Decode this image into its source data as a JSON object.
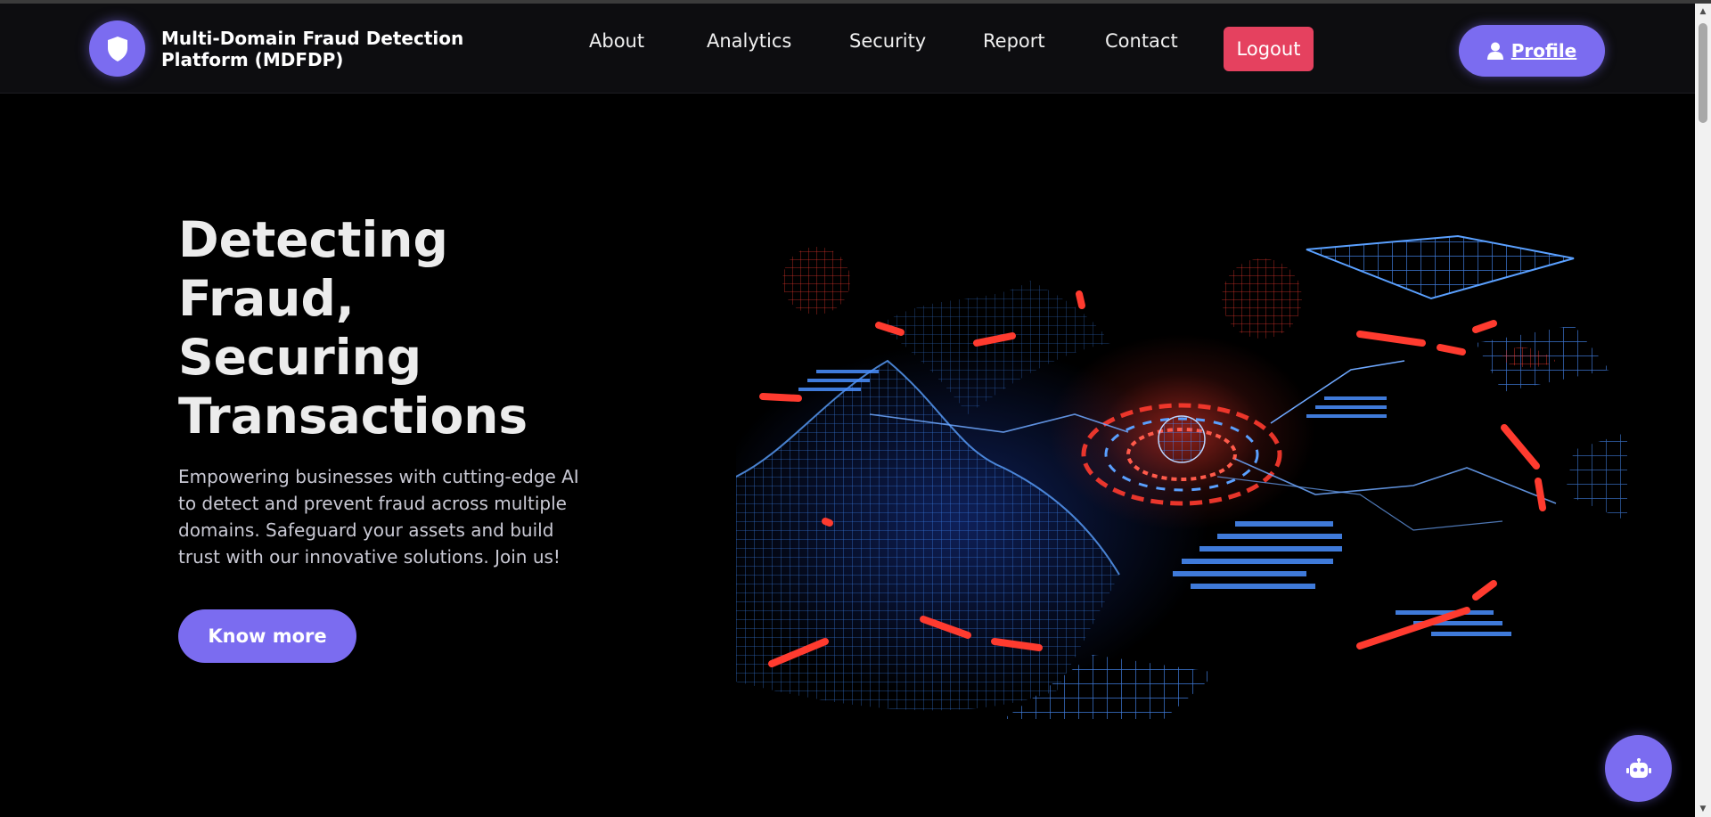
{
  "brand": {
    "name_line1": "Multi-Domain Fraud Detection",
    "name_line2": "Platform (MDFDP)",
    "logo_icon": "shield-icon"
  },
  "nav": {
    "links": [
      {
        "label": "About"
      },
      {
        "label": "Analytics"
      },
      {
        "label": "Security"
      },
      {
        "label": "Report"
      },
      {
        "label": "Contact"
      }
    ],
    "logout_label": "Logout",
    "profile_label": "Profile",
    "profile_icon": "user-icon"
  },
  "hero": {
    "title_lines": [
      "Detecting",
      "Fraud,",
      "Securing",
      "Transactions"
    ],
    "description": "Empowering businesses with cutting-edge AI to detect and prevent fraud across multiple domains. Safeguard your assets and build trust with our innovative solutions. Join us!",
    "cta_label": "Know more",
    "image": "cybersecurity-network-illustration"
  },
  "chatbot": {
    "icon": "robot-icon"
  },
  "colors": {
    "accent": "#7b6cf0",
    "logout": "#e5415f",
    "background": "#000000",
    "nav_background": "#0d0d10",
    "neon_blue": "#3f8cff",
    "neon_red": "#ff3b2f"
  }
}
